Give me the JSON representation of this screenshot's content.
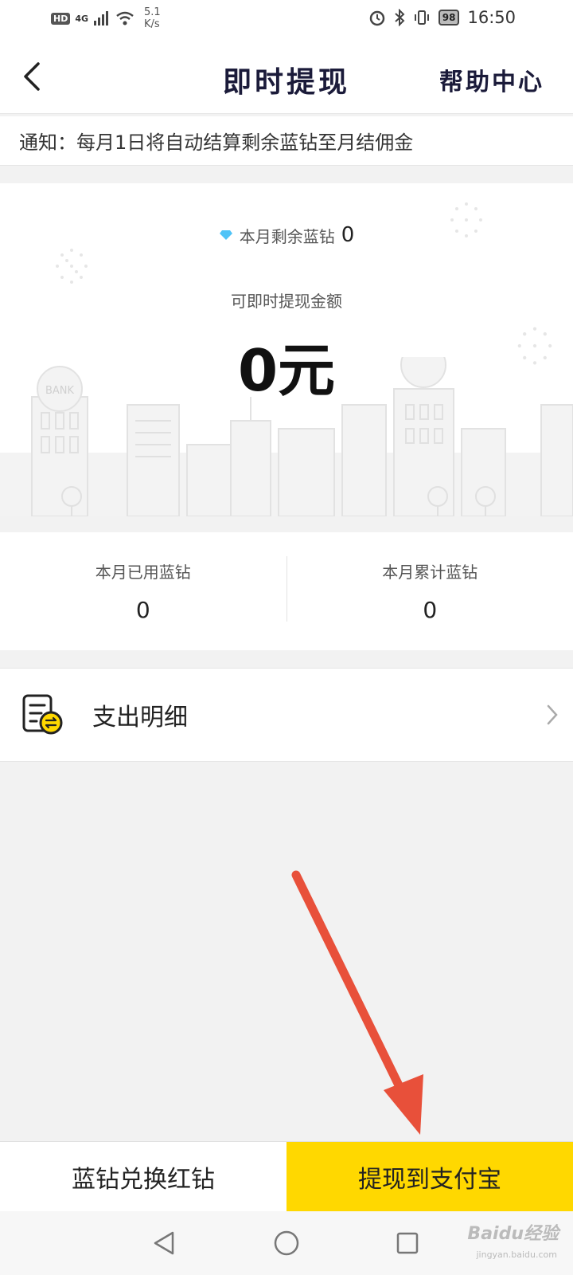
{
  "status_bar": {
    "hd": "HD",
    "network": "4G",
    "speed_value": "5.1",
    "speed_unit": "K/s",
    "battery": "98",
    "time": "16:50"
  },
  "header": {
    "title": "即时提现",
    "help": "帮助中心"
  },
  "notice": {
    "text": "通知：每月1日将自动结算剩余蓝钻至月结佣金"
  },
  "balance": {
    "remaining_label": "本月剩余蓝钻",
    "remaining_value": "0",
    "withdraw_label": "可即时提现金额",
    "withdraw_amount": "0元",
    "illustration_sign": "BANK"
  },
  "stats": {
    "used_label": "本月已用蓝钻",
    "used_value": "0",
    "total_label": "本月累计蓝钻",
    "total_value": "0"
  },
  "detail": {
    "label": "支出明细"
  },
  "bottom": {
    "exchange_label": "蓝钻兑换红钻",
    "alipay_label": "提现到支付宝"
  },
  "watermark": {
    "brand": "Baidu经验",
    "url": "jingyan.baidu.com"
  },
  "colors": {
    "accent_yellow": "#ffd800",
    "annotation_arrow": "#e8503a",
    "diamond": "#4fc3f7"
  },
  "icons": {
    "back": "chevron-left-icon",
    "diamond": "diamond-icon",
    "detail": "receipt-exchange-icon",
    "chevron": "chevron-right-icon"
  }
}
